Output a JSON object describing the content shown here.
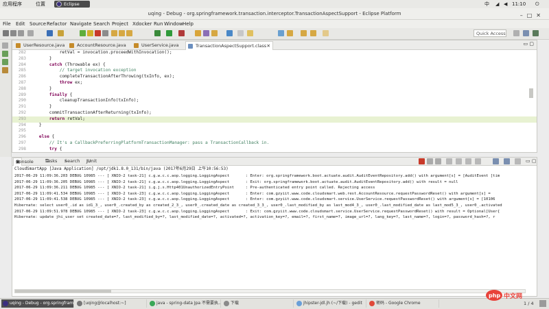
{
  "system_panel": {
    "apps_menu": "应用程序",
    "places_menu": "位置",
    "eclipse_chip": "Eclipse",
    "input_method": "中",
    "time": "11:10"
  },
  "window": {
    "title": "uqing - Debug - org.springframework.transaction.interceptor.TransactionAspectSupport - Eclipse Platform"
  },
  "menu": [
    "File",
    "Edit",
    "Source",
    "Refactor",
    "Navigate",
    "Search",
    "Project",
    "Xdocker",
    "Run",
    "Window",
    "Help"
  ],
  "quick_access": {
    "placeholder": "Quick Access"
  },
  "editor": {
    "tabs": [
      {
        "label": "UserResource.java"
      },
      {
        "label": "AccountResource.java"
      },
      {
        "label": "UserService.java"
      },
      {
        "label": "TransactionAspectSupport.class"
      }
    ],
    "lines": [
      {
        "n": "282",
        "segments": [
          {
            "t": "            retVal = invocation.proceedWithInvocation();",
            "c": ""
          }
        ]
      },
      {
        "n": "283",
        "segments": [
          {
            "t": "        }",
            "c": ""
          }
        ]
      },
      {
        "n": "284",
        "segments": [
          {
            "t": "        ",
            "c": ""
          },
          {
            "t": "catch",
            "c": "kw"
          },
          {
            "t": " (Throwable ex) {",
            "c": ""
          }
        ]
      },
      {
        "n": "285",
        "segments": [
          {
            "t": "            // target invocation exception",
            "c": "cm"
          }
        ]
      },
      {
        "n": "286",
        "segments": [
          {
            "t": "            completeTransactionAfterThrowing(txInfo, ex);",
            "c": ""
          }
        ]
      },
      {
        "n": "287",
        "segments": [
          {
            "t": "            ",
            "c": ""
          },
          {
            "t": "throw",
            "c": "kw"
          },
          {
            "t": " ex;",
            "c": ""
          }
        ]
      },
      {
        "n": "288",
        "segments": [
          {
            "t": "        }",
            "c": ""
          }
        ]
      },
      {
        "n": "289",
        "segments": [
          {
            "t": "        ",
            "c": ""
          },
          {
            "t": "finally",
            "c": "kw"
          },
          {
            "t": " {",
            "c": ""
          }
        ]
      },
      {
        "n": "290",
        "segments": [
          {
            "t": "            cleanupTransactionInfo(txInfo);",
            "c": ""
          }
        ]
      },
      {
        "n": "291",
        "segments": [
          {
            "t": "        }",
            "c": ""
          }
        ]
      },
      {
        "n": "292",
        "segments": [
          {
            "t": "        commitTransactionAfterReturning(txInfo);",
            "c": ""
          }
        ]
      },
      {
        "n": "293",
        "segments": [
          {
            "t": "        ",
            "c": ""
          },
          {
            "t": "return",
            "c": "kw"
          },
          {
            "t": " retVal;",
            "c": ""
          }
        ]
      },
      {
        "n": "294",
        "segments": [
          {
            "t": "    }",
            "c": ""
          }
        ]
      },
      {
        "n": "295",
        "segments": [
          {
            "t": "",
            "c": ""
          }
        ]
      },
      {
        "n": "296",
        "segments": [
          {
            "t": "    ",
            "c": ""
          },
          {
            "t": "else",
            "c": "kw"
          },
          {
            "t": " {",
            "c": ""
          }
        ]
      },
      {
        "n": "297",
        "segments": [
          {
            "t": "        // It's a CallbackPreferringPlatformTransactionManager: pass a TransactionCallback in.",
            "c": "cm"
          }
        ]
      },
      {
        "n": "298",
        "segments": [
          {
            "t": "        ",
            "c": ""
          },
          {
            "t": "try",
            "c": "kw"
          },
          {
            "t": " {",
            "c": ""
          }
        ]
      }
    ],
    "highlight_line": "293"
  },
  "console": {
    "tabs": [
      "Console",
      "Tasks",
      "Search",
      "JUnit"
    ],
    "header": "CloudSmartApp [Java Application] /opt/jdk1.8.0_131/bin/java (2017年6月29日 上午10:56:53)",
    "log": [
      "2017-06-29 11:09:36.203 DEBUG 10985 --- [ XNIO-2 task-21] c.g.w.c.c.aop.logging.LoggingAspect       : Enter: org.springframework.boot.actuate.audit.AuditEventRepository.add() with argument[s] = [AuditEvent [tim",
      "2017-06-29 11:09:36.205 DEBUG 10985 --- [ XNIO-2 task-21] c.g.w.c.c.aop.logging.LoggingAspect       : Exit: org.springframework.boot.actuate.audit.AuditEventRepository.add() with result = null",
      "2017-06-29 11:09:36.211 DEBUG 10985 --- [ XNIO-2 task-21] i.g.j.s.Http401UnauthorizedEntryPoint     : Pre-authenticated entry point called. Rejecting access",
      "2017-06-29 11:09:41.534 DEBUG 10985 --- [ XNIO-2 task-23] c.g.w.c.c.aop.logging.LoggingAspect       : Enter: com.gzyiit.www.code.cloudsmart.web.rest.AccountResource.requestPasswordReset() with argument[s] =",
      "2017-06-29 11:09:41.538 DEBUG 10985 --- [ XNIO-2 task-23] c.g.w.c.c.aop.logging.LoggingAspect       : Enter: com.gzyiit.www.code.cloudsmart.service.UserService.requestPasswordReset() with argument[s] = [10106",
      "Hibernate: select user0_.id as id1_3_, user0_.created_by as created_2_3_, user0_.created_date as created_3_3_, user0_.last_modified_by as last_mod4_3_, user0_.last_modified_date as last_mod5_3_, user0_.activated",
      "2017-06-29 11:09:51.978 DEBUG 10985 --- [ XNIO-2 task-23] c.g.w.c.c.aop.logging.LoggingAspect       : Exit: com.gzyiit.www.code.cloudsmart.service.UserService.requestPasswordReset() with result = Optional[User{",
      "Hibernate: update jhi_user set created_date=?, last_modified_by=?, last_modified_date=?, activated=?, activation_key=?, email=?, first_name=?, image_url=?, lang_key=?, last_name=?, login=?, password_hash=?, r"
    ]
  },
  "taskbar": {
    "tasks": [
      {
        "label": "uqing - Debug - org.springframew...",
        "active": true,
        "color": "#3b2f7f"
      },
      {
        "label": "[uqing@localhost:~]",
        "active": false,
        "color": "#777777"
      },
      {
        "label": "java - spring-data Jpa 不需要执...",
        "active": false,
        "color": "#3aa757"
      },
      {
        "label": "下载",
        "active": false,
        "color": "#8a8a8a"
      },
      {
        "label": "jhipster-jdl.jh (~/下载) - gedit",
        "active": false,
        "color": "#6a9fd8"
      },
      {
        "label": "密码 - Google Chrome",
        "active": false,
        "color": "#e04a3a"
      }
    ],
    "pager": "1 / 4"
  },
  "watermark": "php中文网"
}
